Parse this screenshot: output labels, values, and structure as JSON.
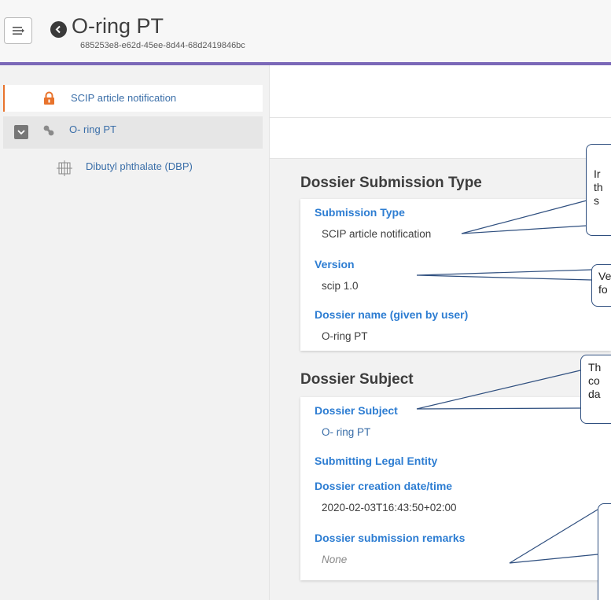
{
  "header": {
    "title": "O-ring PT",
    "subtitle": "685253e8-e62d-45ee-8d44-68d2419846bc"
  },
  "sidebar": {
    "items": [
      {
        "label": "SCIP article notification",
        "icon": "lock-icon"
      },
      {
        "label": "O- ring PT",
        "icon": "link-icon"
      },
      {
        "label": "Dibutyl phthalate (DBP)",
        "icon": "substance-icon"
      }
    ]
  },
  "sections": {
    "submission": {
      "title": "Dossier Submission Type",
      "fields": [
        {
          "label": "Submission Type",
          "value": "SCIP article notification"
        },
        {
          "label": "Version",
          "value": "scip 1.0"
        },
        {
          "label": "Dossier name (given by user)",
          "value": "O-ring PT"
        }
      ]
    },
    "subject": {
      "title": "Dossier Subject",
      "fields": [
        {
          "label": "Dossier Subject",
          "value": "O- ring PT"
        },
        {
          "label": "Submitting Legal Entity",
          "value": ""
        },
        {
          "label": "Dossier creation date/time",
          "value": "2020-02-03T16:43:50+02:00"
        },
        {
          "label": "Dossier submission remarks",
          "value": "None"
        }
      ]
    }
  },
  "callouts": [
    {
      "lines": [
        "Ir",
        "th",
        "s"
      ]
    },
    {
      "lines": [
        "Ve",
        "fo"
      ]
    },
    {
      "lines": [
        "Th",
        "co",
        "da"
      ]
    },
    {
      "lines": []
    }
  ],
  "colors": {
    "accent": "#7b68b8",
    "label_blue": "#2d7dd2",
    "link_blue": "#3a6ea8",
    "active_border": "#e8732c"
  }
}
